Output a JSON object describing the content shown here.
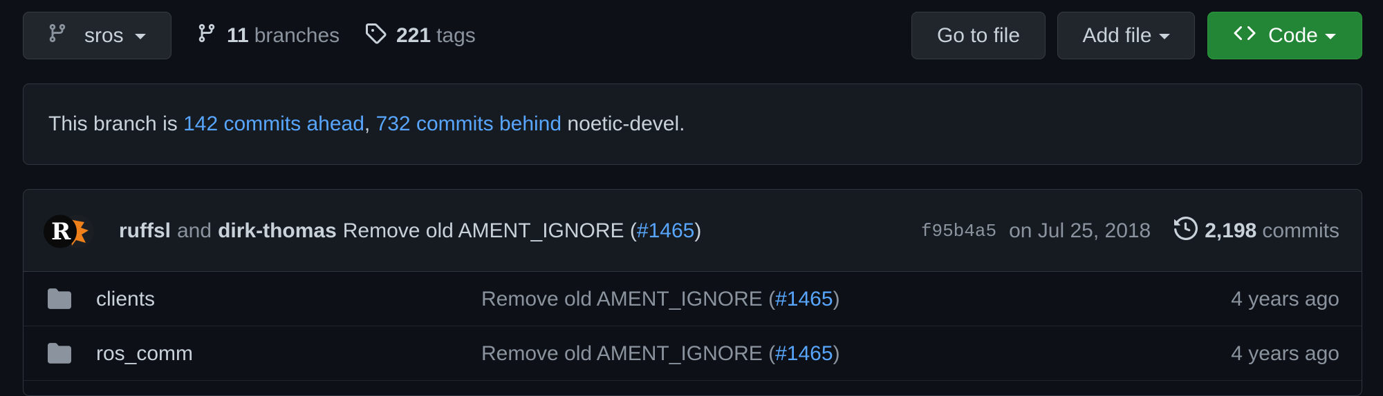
{
  "toolbar": {
    "branch_name": "sros",
    "branches_count": "11",
    "branches_label": "branches",
    "tags_count": "221",
    "tags_label": "tags",
    "goto_file_label": "Go to file",
    "add_file_label": "Add file",
    "code_label": "Code"
  },
  "banner": {
    "prefix": "This branch is ",
    "ahead_link": "142 commits ahead",
    "separator": ", ",
    "behind_link": "732 commits behind",
    "suffix": " noetic-devel."
  },
  "latest_commit": {
    "author1": "ruffsl",
    "and_text": "and",
    "author2": "dirk-thomas",
    "message": "Remove old AMENT_IGNORE (",
    "pr_link": "#1465",
    "close_paren": ")",
    "sha": "f95b4a5",
    "date": "on Jul 25, 2018",
    "commit_count": "2,198",
    "commits_label": "commits"
  },
  "files": [
    {
      "name": "clients",
      "commit_message": "Remove old AMENT_IGNORE (",
      "pr_link": "#1465",
      "close_paren": ")",
      "age": "4 years ago"
    },
    {
      "name": "ros_comm",
      "commit_message": "Remove old AMENT_IGNORE (",
      "pr_link": "#1465",
      "close_paren": ")",
      "age": "4 years ago"
    }
  ],
  "colors": {
    "background": "#0d1117",
    "link": "#58a6ff",
    "code_button": "#238636",
    "folder_icon": "#8b949e"
  },
  "icons": [
    "git-branch-icon",
    "tag-icon",
    "code-icon",
    "history-icon",
    "folder-icon"
  ]
}
